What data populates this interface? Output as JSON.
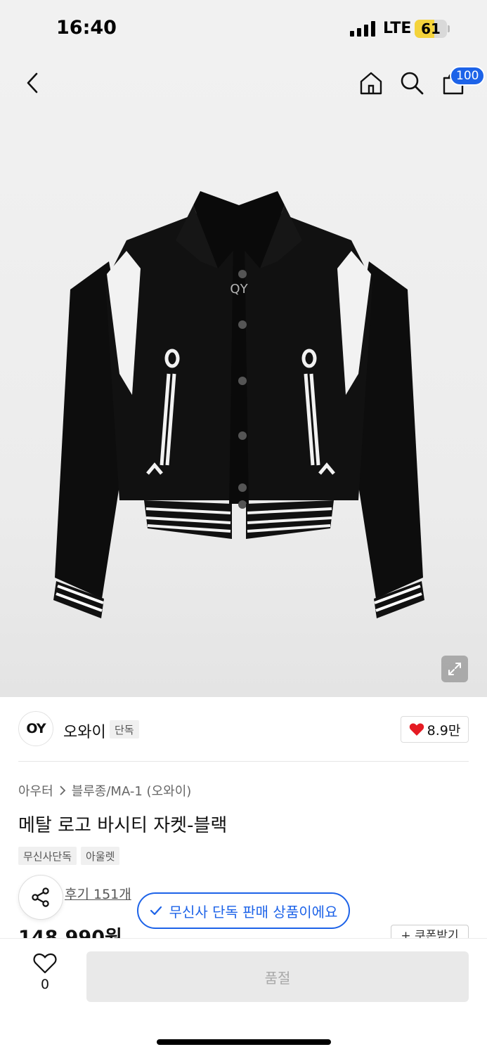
{
  "status_bar": {
    "time": "16:40",
    "network": "LTE",
    "battery": "61",
    "battery_level": 0.61
  },
  "header": {
    "back_icon": "chevron-left-icon",
    "home_icon": "home-icon",
    "search_icon": "search-icon",
    "cart_icon": "shopping-bag-icon",
    "cart_badge": "100",
    "badge_color": "#1d63e8"
  },
  "gallery": {
    "expand_icon": "expand-icon"
  },
  "brand": {
    "logo_text": "OY",
    "name": "오와이",
    "tag": "단독",
    "likes": "8.9만",
    "heart_color": "#e51b23"
  },
  "product": {
    "breadcrumb": [
      "아우터",
      "블루종/MA-1 (오와이)"
    ],
    "title": "메탈 로고 바시티 자켓-블랙",
    "chips": [
      "무신사단독",
      "아울렛"
    ],
    "reviews": "후기 151개",
    "exclusive_notice": "무신사 단독 판매 상품이에요",
    "price": "148,990원",
    "coupon": "+ 쿠폰받기"
  },
  "bottom": {
    "wish_count": "0",
    "cta": "품절"
  },
  "accent_color": "#1d63e8"
}
